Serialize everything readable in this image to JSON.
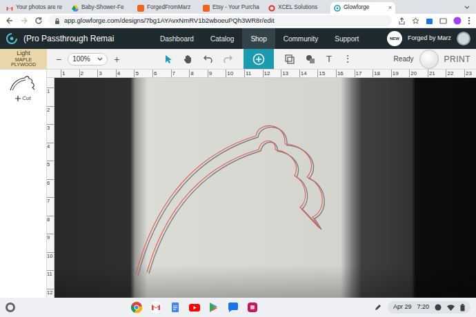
{
  "browser": {
    "tabs": [
      {
        "label": "Your photos are re",
        "selected": false,
        "kind": "gmail"
      },
      {
        "label": "Baby-Shower-Fe",
        "selected": false,
        "kind": "drive"
      },
      {
        "label": "ForgedFromMarz",
        "selected": false,
        "kind": "etsy"
      },
      {
        "label": "Etsy - Your Purcha",
        "selected": false,
        "kind": "etsy"
      },
      {
        "label": "XCEL Solutions",
        "selected": false,
        "kind": "xcel"
      },
      {
        "label": "Glowforge",
        "selected": true,
        "kind": "glowforge"
      }
    ],
    "tab_close": "×",
    "url": "app.glowforge.com/designs/7bg1AYAvxNmRV1b2wboeuPQh3WR8r/edit"
  },
  "app": {
    "title": "(Pro Passthrough Remai",
    "nav": [
      {
        "label": "Dashboard",
        "selected": false
      },
      {
        "label": "Catalog",
        "selected": false
      },
      {
        "label": "Shop",
        "selected": true
      },
      {
        "label": "Community",
        "selected": false
      },
      {
        "label": "Support",
        "selected": false
      }
    ],
    "badge": "NEW",
    "user": "Forged by Marz"
  },
  "toolbar": {
    "material": {
      "shade": "Light",
      "name": "MAPLE PLYWOOD"
    },
    "zoom_out": "−",
    "zoom": "100%",
    "zoom_in": "+",
    "text_tool": "T",
    "more": "⋮",
    "status": "Ready",
    "print": "PRINT"
  },
  "layers": [
    {
      "label": "Cut"
    }
  ],
  "rulers": {
    "top": [
      "1",
      "2",
      "3",
      "4",
      "5",
      "6",
      "7",
      "8",
      "9",
      "10",
      "11",
      "12",
      "13",
      "14",
      "15",
      "16",
      "17",
      "18",
      "19",
      "20",
      "21",
      "22",
      "23"
    ],
    "left": [
      "1",
      "2",
      "3",
      "4",
      "5",
      "6",
      "7",
      "8",
      "9",
      "10",
      "11",
      "12"
    ]
  },
  "taskbar": {
    "date": "Apr 29",
    "time": "7:20"
  }
}
